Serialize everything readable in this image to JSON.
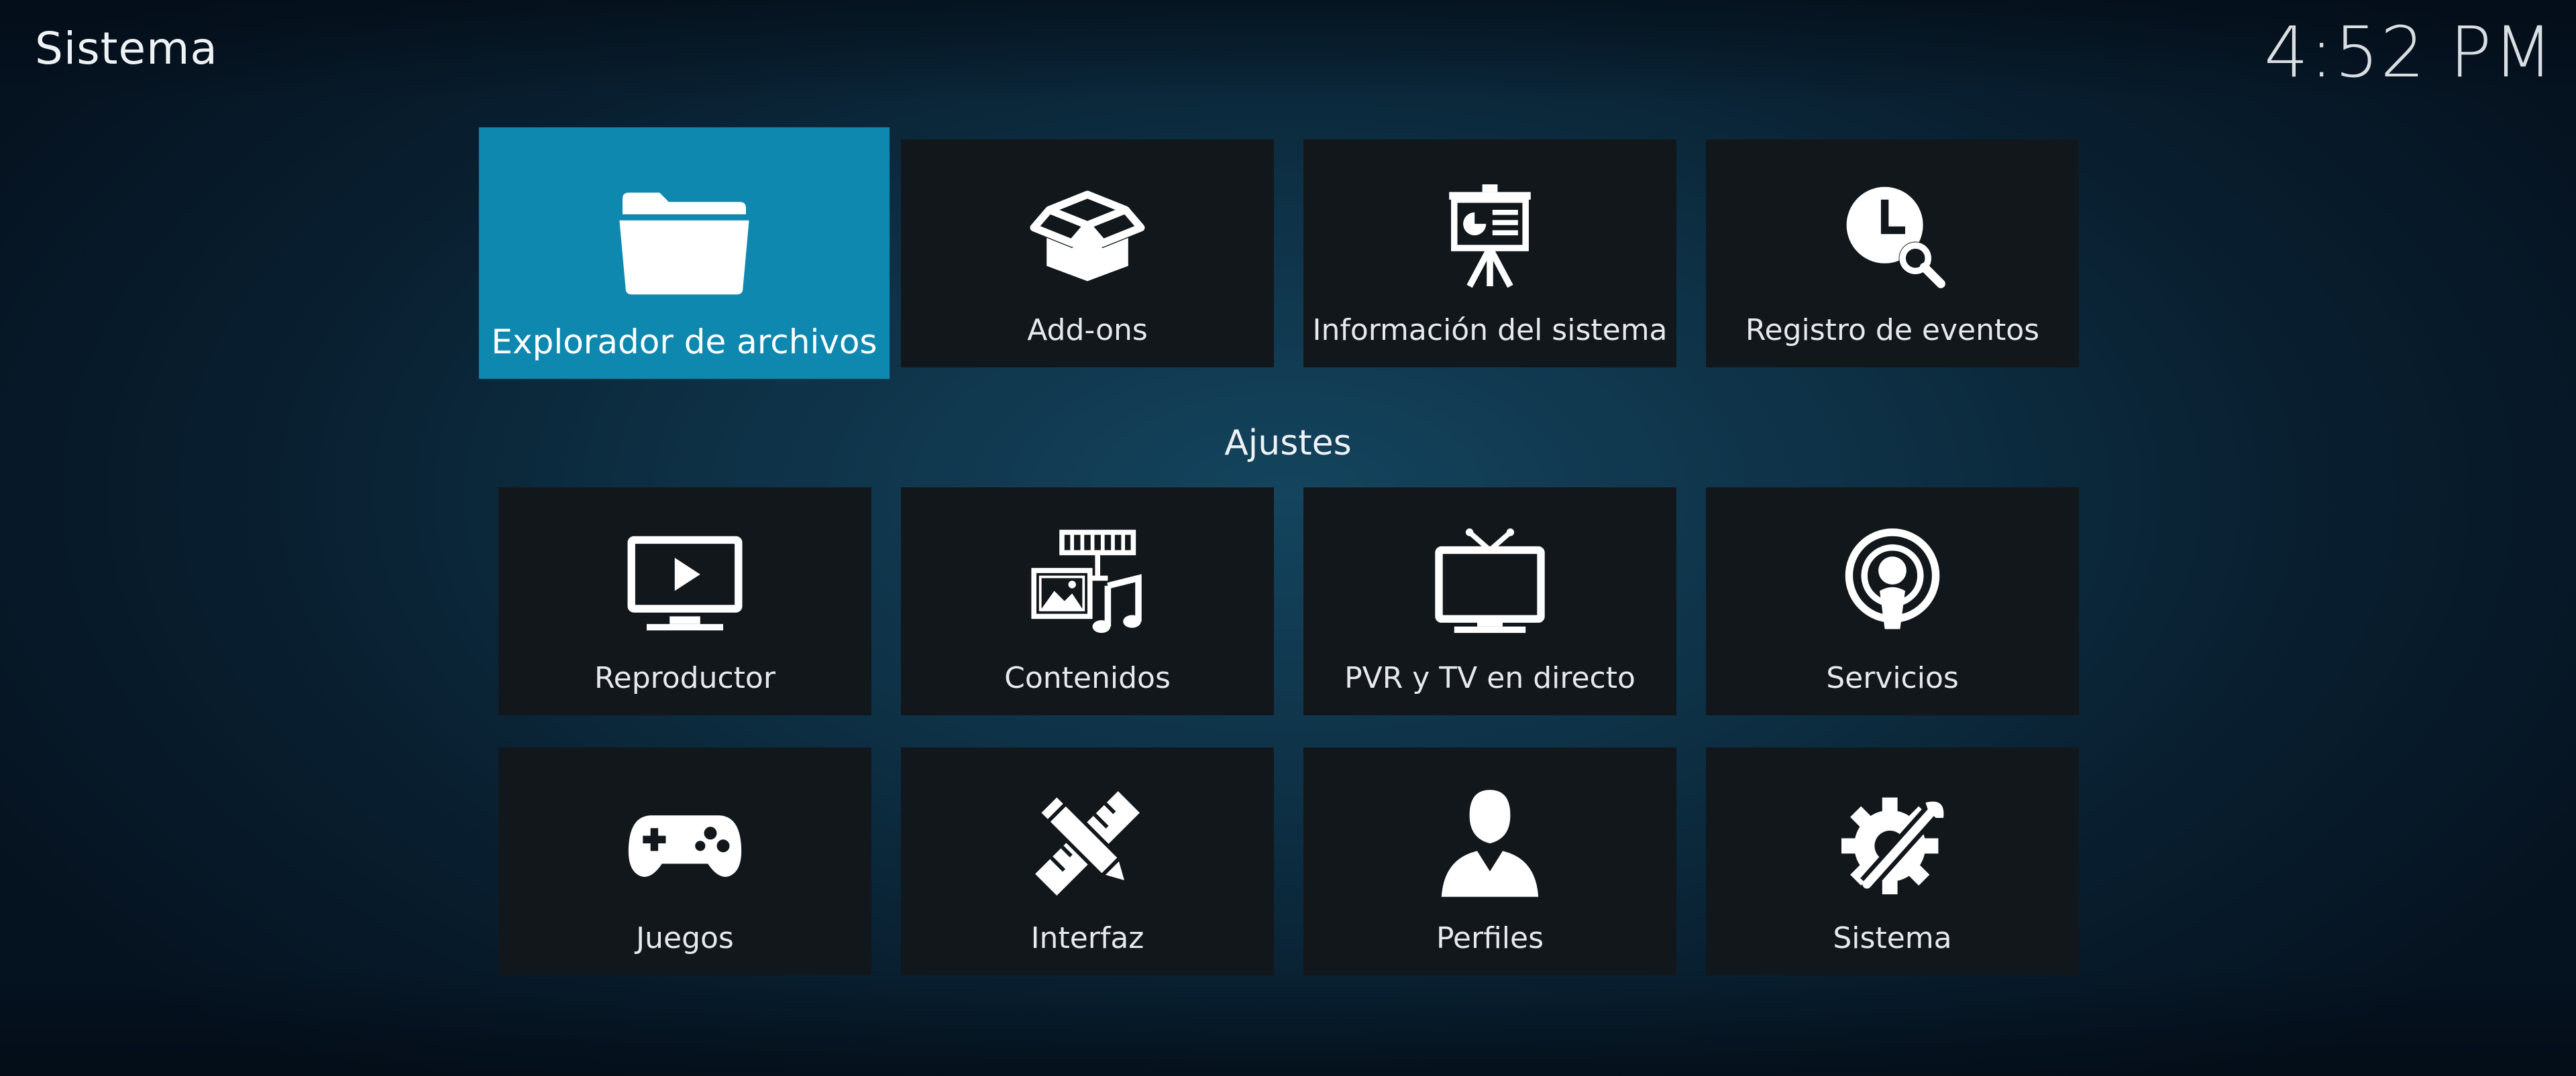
{
  "header": {
    "title": "Sistema",
    "clock": "4:52 PM"
  },
  "top_row": [
    {
      "label": "Explorador de archivos",
      "icon": "folder-icon",
      "focused": true
    },
    {
      "label": "Add-ons",
      "icon": "box-icon"
    },
    {
      "label": "Información del sistema",
      "icon": "presentation-board-icon"
    },
    {
      "label": "Registro de eventos",
      "icon": "clock-search-icon"
    }
  ],
  "settings": {
    "title": "Ajustes",
    "items": [
      {
        "label": "Reproductor",
        "icon": "tv-play-icon"
      },
      {
        "label": "Contenidos",
        "icon": "media-library-icon"
      },
      {
        "label": "PVR y TV en directo",
        "icon": "tv-antenna-icon"
      },
      {
        "label": "Servicios",
        "icon": "broadcast-icon"
      },
      {
        "label": "Juegos",
        "icon": "gamepad-icon"
      },
      {
        "label": "Interfaz",
        "icon": "pencil-ruler-icon"
      },
      {
        "label": "Perfiles",
        "icon": "user-profile-icon"
      },
      {
        "label": "Sistema",
        "icon": "gear-wrench-icon"
      }
    ]
  },
  "colors": {
    "focus": "#0f88b0",
    "tile": "#12171c",
    "background_center": "#14445e",
    "background_edge": "#051220"
  }
}
